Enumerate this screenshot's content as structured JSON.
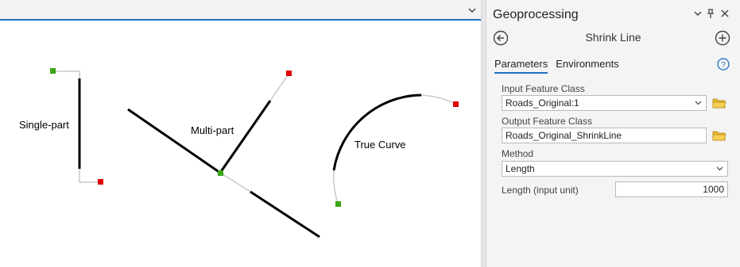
{
  "map": {
    "labels": {
      "single_part": "Single-part",
      "multi_part": "Multi-part",
      "true_curve": "True Curve"
    },
    "colors": {
      "line_shrunk": "#000000",
      "line_removed": "#c8c8c8",
      "start_vertex": "#3aa614",
      "end_vertex": "#e00000"
    }
  },
  "pane": {
    "title": "Geoprocessing",
    "icons": {
      "dropdown": "chevron-down-icon",
      "pin": "pin-icon",
      "close": "close-icon"
    },
    "tool_name": "Shrink Line",
    "back_icon": "back-arrow-icon",
    "add_icon": "plus-circle-icon",
    "tabs": [
      {
        "label": "Parameters",
        "active": true
      },
      {
        "label": "Environments",
        "active": false
      }
    ],
    "help_icon": "help-icon",
    "params": {
      "input_label": "Input Feature Class",
      "input_value": "Roads_Original:1",
      "output_label": "Output Feature Class",
      "output_value": "Roads_Original_ShrinkLine",
      "method_label": "Method",
      "method_value": "Length",
      "length_label": "Length (input unit)",
      "length_value": "1000"
    },
    "accent_color": "#1c6fc4",
    "folder_color": "#e8b830"
  }
}
